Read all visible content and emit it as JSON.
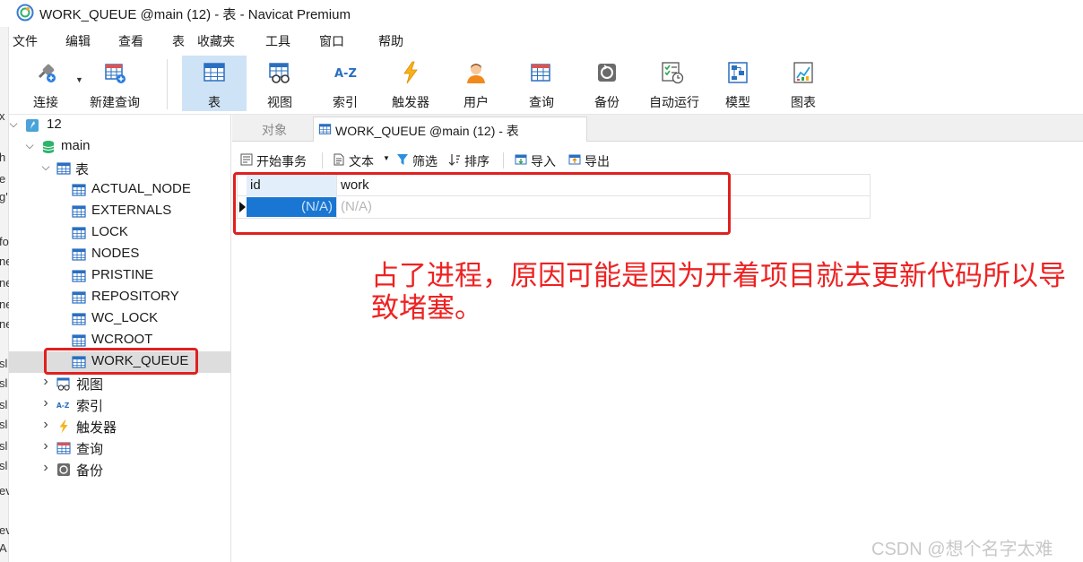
{
  "window": {
    "title": "WORK_QUEUE @main (12) - 表 - Navicat Premium"
  },
  "left_edge_fragments": [
    "x",
    "h",
    "e",
    "g'",
    "fo",
    "ne",
    "ne",
    "ne",
    "ne",
    "sl",
    "sl",
    "sl",
    "sl",
    "sl",
    "sl",
    "ev",
    "ev",
    "A"
  ],
  "menu": {
    "items": [
      "文件",
      "编辑",
      "查看",
      "表",
      "收藏夹",
      "工具",
      "窗口",
      "帮助"
    ]
  },
  "toolbar": {
    "items": [
      {
        "label": "连接",
        "icon": "plug-icon"
      },
      {
        "label": "新建查询",
        "icon": "new-query-icon"
      },
      {
        "label": "表",
        "icon": "table-icon",
        "active": true
      },
      {
        "label": "视图",
        "icon": "view-icon"
      },
      {
        "label": "索引",
        "icon": "index-icon"
      },
      {
        "label": "触发器",
        "icon": "trigger-icon"
      },
      {
        "label": "用户",
        "icon": "user-icon"
      },
      {
        "label": "查询",
        "icon": "query-icon"
      },
      {
        "label": "备份",
        "icon": "backup-icon"
      },
      {
        "label": "自动运行",
        "icon": "auto-run-icon"
      },
      {
        "label": "模型",
        "icon": "model-icon"
      },
      {
        "label": "图表",
        "icon": "chart-icon"
      }
    ]
  },
  "tree": {
    "connection": "12",
    "database": "main",
    "tables_folder": "表",
    "tables": [
      "ACTUAL_NODE",
      "EXTERNALS",
      "LOCK",
      "NODES",
      "PRISTINE",
      "REPOSITORY",
      "WC_LOCK",
      "WCROOT",
      "WORK_QUEUE"
    ],
    "selected_table": "WORK_QUEUE",
    "folders": [
      {
        "label": "视图",
        "icon": "view-icon"
      },
      {
        "label": "索引",
        "icon": "index-icon"
      },
      {
        "label": "触发器",
        "icon": "trigger-icon"
      },
      {
        "label": "查询",
        "icon": "query-icon"
      },
      {
        "label": "备份",
        "icon": "backup-icon"
      }
    ]
  },
  "tabs": {
    "objects_label": "对象",
    "active_label": "WORK_QUEUE @main (12) - 表"
  },
  "subtoolbar": {
    "begin_transaction": "开始事务",
    "text": "文本",
    "filter": "筛选",
    "sort": "排序",
    "import": "导入",
    "export": "导出"
  },
  "grid": {
    "columns": [
      "id",
      "work"
    ],
    "rows": [
      [
        "(N/A)",
        "(N/A)"
      ]
    ]
  },
  "annotation": {
    "text": "占了进程，原因可能是因为开着项目就去更新代码所以导致堵塞。",
    "color": "#ee2222"
  },
  "watermark": "CSDN @想个名字太难",
  "colors": {
    "highlight_red": "#e02020",
    "selection_blue": "#1976d2",
    "active_tool_bg": "#cfe3f6"
  }
}
